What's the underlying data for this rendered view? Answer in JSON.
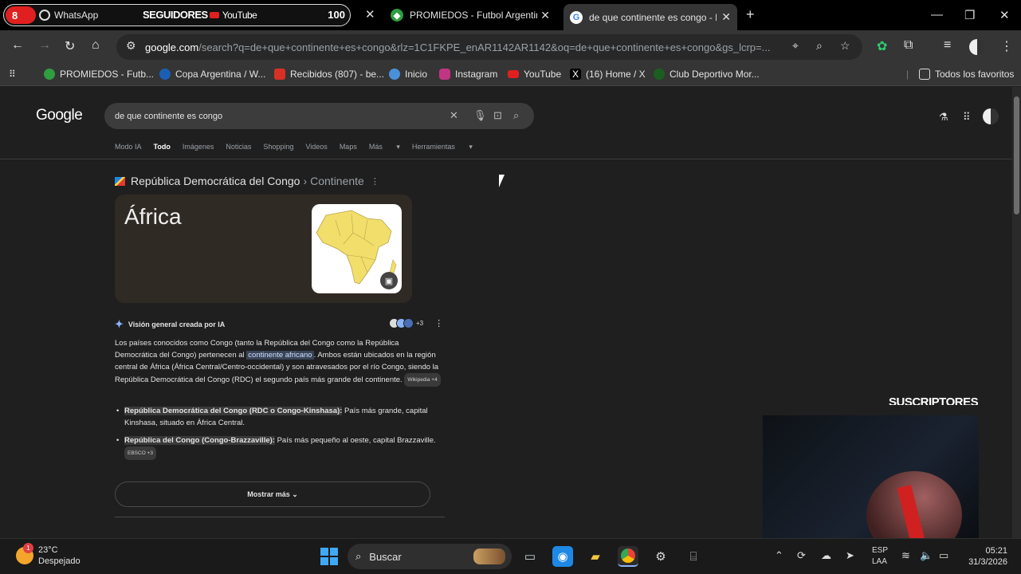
{
  "browser": {
    "tabs": [
      {
        "badge": "8",
        "label_a": "WhatsApp",
        "label_b": "SEGUIDORES",
        "label_c": "YouTube",
        "count": "100"
      },
      {
        "label": "PROMIEDOS - Futbol Argentino"
      },
      {
        "label": "de que continente es congo - B"
      }
    ],
    "url_host": "google.com",
    "url_rest": "/search?q=de+que+continente+es+congo&rlz=1C1FKPE_enAR1142AR1142&oq=de+que+continente+es+congo&gs_lcrp=...",
    "bookmarks": [
      {
        "label": "PROMIEDOS - Futb...",
        "icon": "promiedos-icon",
        "color": "#2e9e3e"
      },
      {
        "label": "Copa Argentina / W...",
        "icon": "globe-icon",
        "color": "#1a5fb4"
      },
      {
        "label": "Recibidos (807) - be...",
        "icon": "gmail-icon",
        "color": "#d93025"
      },
      {
        "label": "Inicio",
        "icon": "cloud-icon",
        "color": "#4a90d9"
      },
      {
        "label": "Instagram",
        "icon": "instagram-icon",
        "color": "#c13584"
      },
      {
        "label": "YouTube",
        "icon": "youtube-icon",
        "color": "#e02020"
      },
      {
        "label": "(16) Home / X",
        "icon": "x-icon",
        "color": "#000000"
      },
      {
        "label": "Club Deportivo Mor...",
        "icon": "club-icon",
        "color": "#1b5e20"
      }
    ],
    "all_bookmarks": "Todos los favoritos"
  },
  "google": {
    "logo": "Google",
    "query": "de que continente es congo",
    "tabs": [
      "Modo IA",
      "Todo",
      "Imágenes",
      "Noticias",
      "Shopping",
      "Videos",
      "Maps",
      "Más",
      "Herramientas"
    ],
    "active_tab": "Todo",
    "entity": "República Democrática del Congo",
    "entity_sep": "›",
    "attribute": "Continente",
    "answer": "África",
    "ai_title": "Visión general creada por IA",
    "ai_sources_more": "+3",
    "para_1": "Los países conocidos como Congo (tanto la República del Congo como la República Democrática del Congo) pertenecen al ",
    "para_hl": "continente africano",
    "para_2": ". Ambos están ubicados en la región central de África (África Central/Centro-occidental) y son atravesados por el río Congo, siendo la República Democrática del Congo (RDC) el segundo país más grande del continente.",
    "para_chip": "Wikipedia +4",
    "bullet_1_bold": "República Democrática del Congo (RDC o Congo-Kinshasa):",
    "bullet_1_text": " País más grande, capital Kinshasa, situado en África Central.",
    "bullet_2_bold": "República del Congo (Congo-Brazzaville):",
    "bullet_2_text": " País más pequeño al oeste, capital Brazzaville.",
    "bullet_2_chip": "EBSCO +3",
    "show_more": "Mostrar más"
  },
  "overlay": {
    "subscribers_label": "SUSCRIPTORES"
  },
  "taskbar": {
    "temp": "23°C",
    "weather": "Despejado",
    "weather_badge": "1",
    "search": "Buscar",
    "lang_1": "ESP",
    "lang_2": "LAA",
    "time": "05:21",
    "date": "31/3/2026"
  }
}
